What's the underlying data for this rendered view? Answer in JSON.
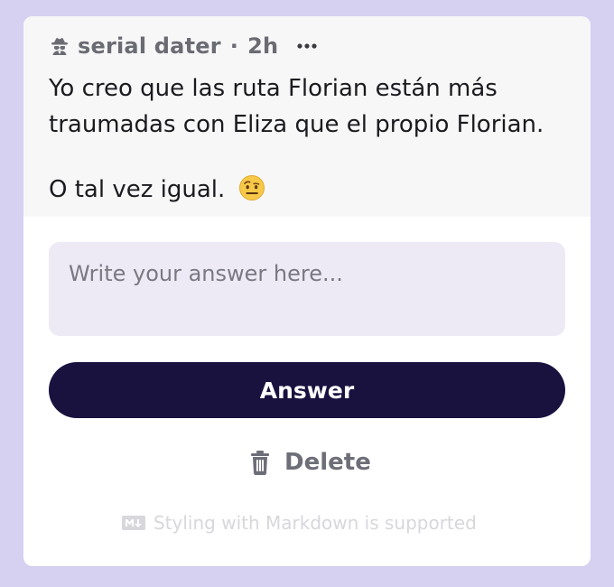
{
  "post": {
    "username": "serial dater",
    "separator": "·",
    "age": "2h",
    "more_icon": "more-horizontal-icon",
    "lines": [
      "Yo creo que las ruta Florian están más",
      "traumadas con Eliza que el propio Florian.",
      "O tal vez igual."
    ],
    "emoji_icon": "raised-eyebrow-emoji"
  },
  "reply": {
    "placeholder": "Write your answer here...",
    "value": "",
    "answer_label": "Answer",
    "delete_label": "Delete",
    "markdown_hint": "Styling with Markdown is supported"
  },
  "colors": {
    "background": "#d6d1f1",
    "card": "#ffffff",
    "post_area": "#f7f7f8",
    "answer_field": "#eeeaf5",
    "answer_button": "#19123f",
    "muted_text": "#6e6e78"
  }
}
